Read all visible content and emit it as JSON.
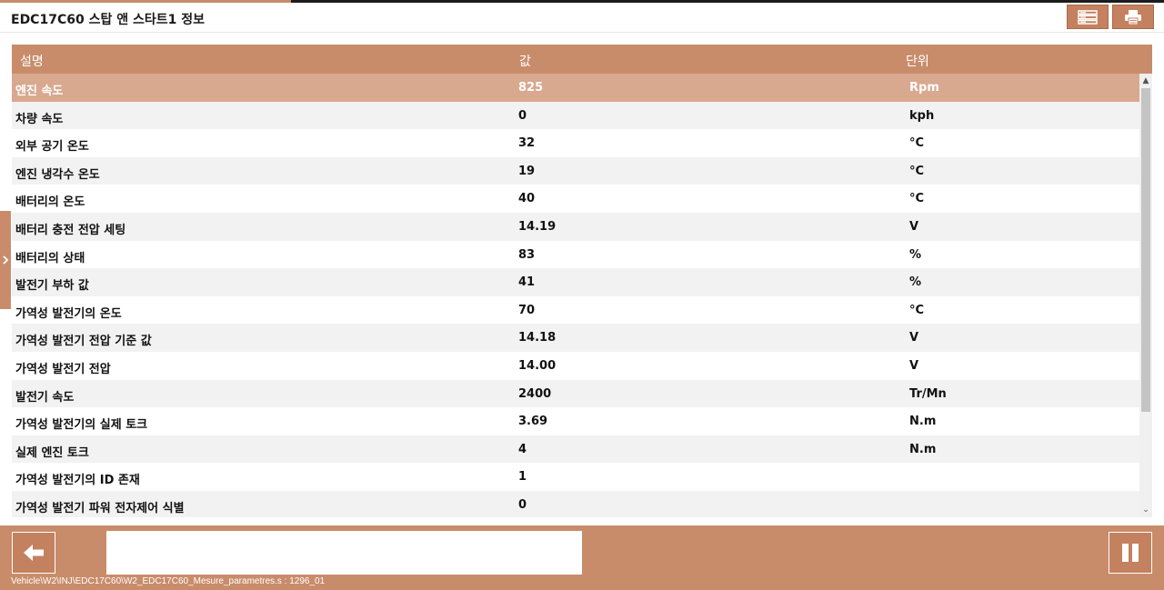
{
  "window": {
    "title": "EDC17C60 스탑 앤 스타트1 정보"
  },
  "toolbar": {
    "list_icon": "list-icon",
    "print_icon": "printer-icon"
  },
  "table": {
    "headers": [
      "설명",
      "값",
      "단위"
    ],
    "rows": [
      {
        "desc": "엔진 속도",
        "value": "825",
        "unit": "Rpm"
      },
      {
        "desc": "차량 속도",
        "value": "0",
        "unit": "kph"
      },
      {
        "desc": "외부 공기 온도",
        "value": "32",
        "unit": "°C"
      },
      {
        "desc": "엔진 냉각수 온도",
        "value": "19",
        "unit": "°C"
      },
      {
        "desc": "배터리의 온도",
        "value": "40",
        "unit": "°C"
      },
      {
        "desc": "배터리 충전 전압 세팅",
        "value": "14.19",
        "unit": "V"
      },
      {
        "desc": "배터리의 상태",
        "value": "83",
        "unit": "%"
      },
      {
        "desc": "발전기 부하 값",
        "value": "41",
        "unit": "%"
      },
      {
        "desc": "가역성 발전기의 온도",
        "value": "70",
        "unit": "°C"
      },
      {
        "desc": "가역성 발전기 전압 기준 값",
        "value": "14.18",
        "unit": "V"
      },
      {
        "desc": "가역성 발전기 전압",
        "value": "14.00",
        "unit": "V"
      },
      {
        "desc": "발전기 속도",
        "value": "2400",
        "unit": "Tr/Mn"
      },
      {
        "desc": "가역성 발전기의 실제 토크",
        "value": "3.69",
        "unit": "N.m"
      },
      {
        "desc": "실제 엔진 토크",
        "value": "4",
        "unit": "N.m"
      },
      {
        "desc": "가역성 발전기의 ID 존재",
        "value": "1",
        "unit": ""
      },
      {
        "desc": "가역성 발전기 파워 전자제어 식별",
        "value": "0",
        "unit": ""
      }
    ]
  },
  "footer": {
    "status_text": "",
    "path": "Vehicle\\W2\\INJ\\EDC17C60\\W2_EDC17C60_Mesure_parametres.s : 1296_01"
  },
  "colors": {
    "accent": "#c98c6b",
    "button": "#c4815f",
    "selected_row": "#d8a88f"
  }
}
